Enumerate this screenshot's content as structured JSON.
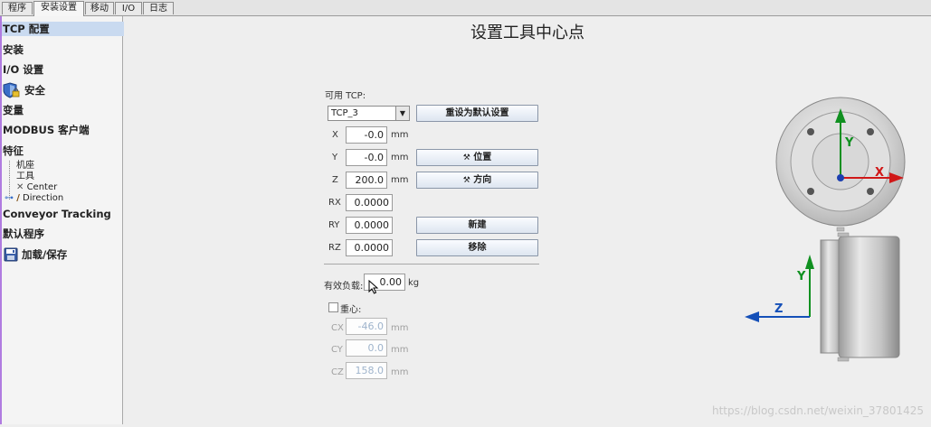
{
  "tabs": [
    "程序",
    "安装设置",
    "移动",
    "I/O",
    "日志"
  ],
  "sidebar": {
    "items": [
      "TCP 配置",
      "安装",
      "I/O 设置",
      "安全",
      "变量",
      "MODBUS 客户端",
      "特征"
    ],
    "feature_children": [
      "机座",
      "工具",
      "Center",
      "Direction"
    ],
    "items_after": [
      "Conveyor Tracking",
      "默认程序",
      "加载/保存"
    ]
  },
  "main": {
    "title": "设置工具中心点",
    "available_tcp_label": "可用 TCP:",
    "tcp_selected": "TCP_3",
    "reset_default_button": "重设为默认设置",
    "position_button": "位置",
    "orientation_button": "方向",
    "new_button": "新建",
    "remove_button": "移除",
    "coords": [
      {
        "label": "X",
        "value": "-0.0",
        "unit": "mm"
      },
      {
        "label": "Y",
        "value": "-0.0",
        "unit": "mm"
      },
      {
        "label": "Z",
        "value": "200.0",
        "unit": "mm"
      },
      {
        "label": "RX",
        "value": "0.0000",
        "unit": ""
      },
      {
        "label": "RY",
        "value": "0.0000",
        "unit": ""
      },
      {
        "label": "RZ",
        "value": "0.0000",
        "unit": ""
      }
    ],
    "payload_label": "有效负载:",
    "payload_value": "0.00",
    "payload_unit": "kg",
    "cog_label": "重心:",
    "cog": [
      {
        "label": "CX",
        "value": "-46.0",
        "unit": "mm"
      },
      {
        "label": "CY",
        "value": "0.0",
        "unit": "mm"
      },
      {
        "label": "CZ",
        "value": "158.0",
        "unit": "mm"
      }
    ]
  },
  "diagram": {
    "axis_x": "X",
    "axis_y": "Y",
    "axis_y_side": "Y",
    "axis_z": "Z",
    "colors": {
      "x": "#d01818",
      "y": "#109020",
      "z": "#1550b8"
    }
  },
  "watermark": "https://blog.csdn.net/weixin_37801425"
}
